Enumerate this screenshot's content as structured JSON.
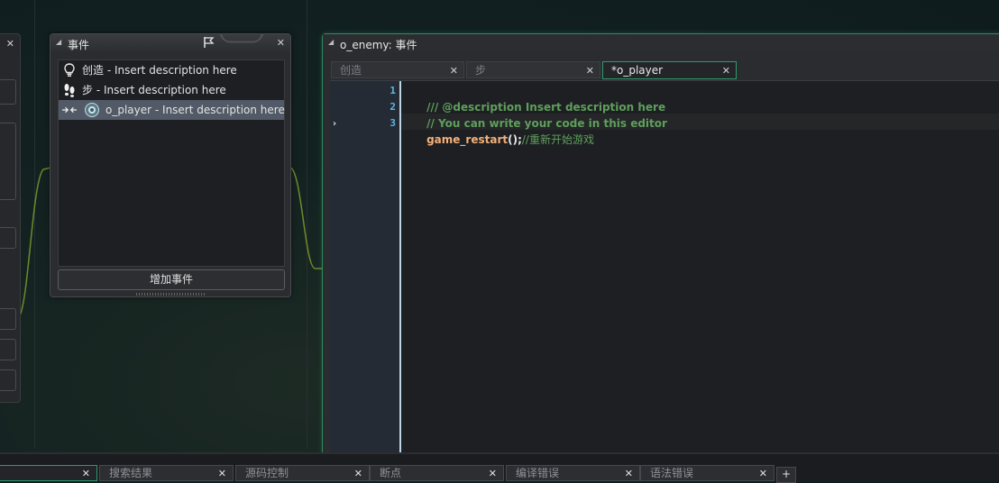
{
  "events_panel": {
    "title": "事件",
    "items": [
      {
        "label": "创造 - Insert description here",
        "icon": "lightbulb-icon"
      },
      {
        "label": "步 - Insert description here",
        "icon": "footsteps-icon"
      },
      {
        "label": "o_player - Insert description here",
        "icon": "collision-icon"
      }
    ],
    "add_button": "增加事件",
    "close_symbol": "✕"
  },
  "editor": {
    "title": "o_enemy: 事件",
    "tabs": [
      {
        "label": "创造",
        "active": false
      },
      {
        "label": "步",
        "active": false
      },
      {
        "label": "*o_player",
        "active": true
      }
    ],
    "line_numbers": [
      "1",
      "2",
      "3"
    ],
    "code": {
      "line1": "/// @description Insert description here",
      "line2": "// You can write your code in this editor",
      "line3_func": "game_restart",
      "line3_punct": "();",
      "line3_comment": "//重新开始游戏"
    },
    "marker": "›"
  },
  "bottom_tabs": [
    {
      "label": "",
      "active": true
    },
    {
      "label": "搜索结果"
    },
    {
      "label": "源码控制"
    },
    {
      "label": "断点"
    },
    {
      "label": "编译错误"
    },
    {
      "label": "语法错误"
    }
  ],
  "bottom_add": "+",
  "colors": {
    "accent_green": "#2e9a6c",
    "comment": "#5f9f5b",
    "function": "#f3b07a",
    "line_number": "#58b8e8"
  }
}
